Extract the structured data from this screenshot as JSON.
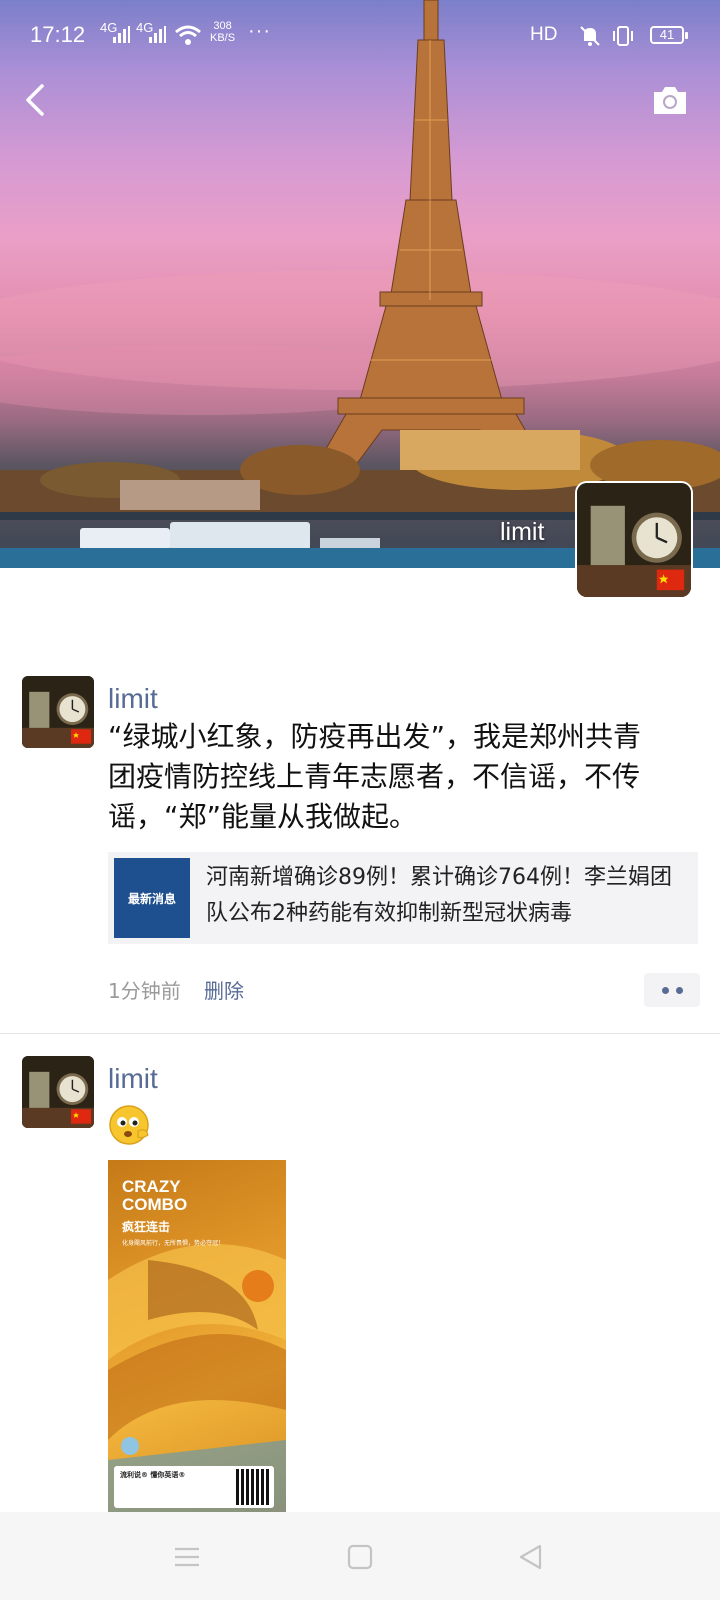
{
  "status_bar": {
    "time": "17:12",
    "signal_1": "4G",
    "signal_2": "4G",
    "speed_value": "308",
    "speed_unit": "KB/S",
    "more": "···",
    "hd": "HD",
    "battery": "41"
  },
  "header": {
    "back_icon": "chevron-left-icon",
    "camera_icon": "camera-icon"
  },
  "profile": {
    "name": "limit"
  },
  "posts": [
    {
      "author": "limit",
      "text": "“绿城小红象，防疫再出发”，我是郑州共青团疫情防控线上青年志愿者，不信谣，不传谣，“郑”能量从我做起。",
      "link": {
        "thumb_label": "最新消息",
        "title": "河南新增确诊89例！累计确诊764例！李兰娟团队公布2种药能有效抑制新型冠状病毒"
      },
      "time": "1分钟前",
      "delete_label": "删除"
    },
    {
      "author": "limit",
      "emoji": "emoji-face-icon",
      "image": {
        "title_line1": "CRAZY",
        "title_line2": "COMBO",
        "subtitle": "疯狂连击",
        "tagline": "化身飓风前行，无所畏惧，势必夺冠！",
        "footer": "流利说® 懂你英语®"
      }
    }
  ],
  "nav_bar": {
    "menu_icon": "menu-icon",
    "home_icon": "square-home-icon",
    "back_icon": "triangle-back-icon"
  },
  "colors": {
    "link_blue": "#576b95",
    "text": "#111111",
    "meta_gray": "#9a9a9a",
    "card_bg": "#f3f3f5"
  }
}
